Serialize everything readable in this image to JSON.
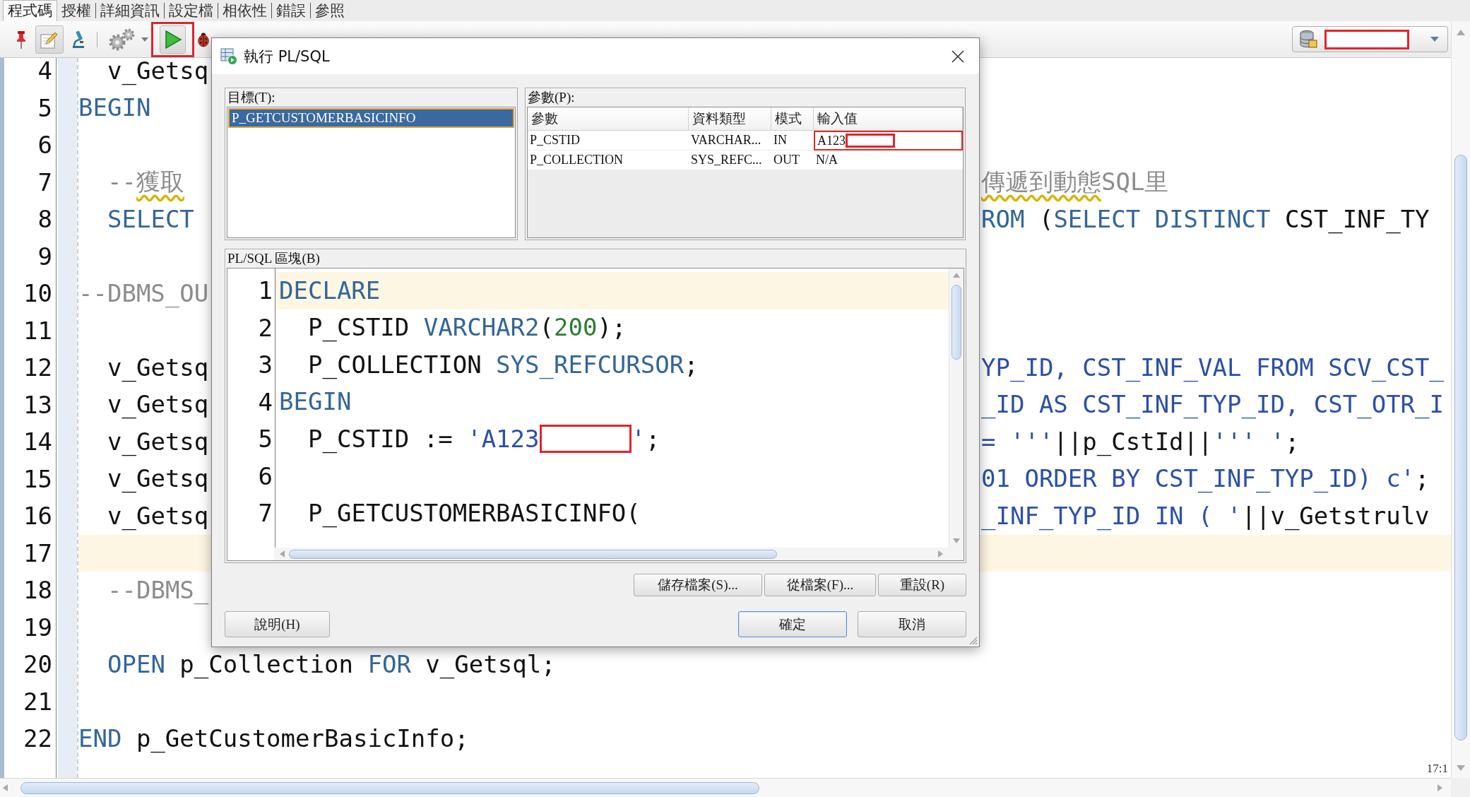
{
  "tabs": [
    {
      "label": "程式碼",
      "selected": true
    },
    {
      "label": "授權",
      "selected": false
    },
    {
      "label": "詳細資訊",
      "selected": false
    },
    {
      "label": "設定檔",
      "selected": false
    },
    {
      "label": "相依性",
      "selected": false
    },
    {
      "label": "錯誤",
      "selected": false
    },
    {
      "label": "參照",
      "selected": false
    }
  ],
  "toolbar": [
    {
      "kind": "pin",
      "pressed": false,
      "highlighted": false
    },
    {
      "kind": "edit",
      "pressed": true,
      "highlighted": false
    },
    {
      "kind": "inspect",
      "pressed": false,
      "highlighted": false
    },
    {
      "kind": "separator"
    },
    {
      "kind": "gears",
      "pressed": false,
      "highlighted": false
    },
    {
      "kind": "dropdown",
      "pressed": false,
      "highlighted": false
    },
    {
      "kind": "run",
      "pressed": true,
      "highlighted": true
    },
    {
      "kind": "debug",
      "pressed": false,
      "highlighted": false
    }
  ],
  "connection": {
    "redacted": true
  },
  "editor": {
    "lines": [
      {
        "number": "4",
        "current": false,
        "indented": true,
        "left": [
          {
            "kind": "plain",
            "text": "v_Getsq"
          }
        ]
      },
      {
        "number": "5",
        "current": false,
        "indented": false,
        "left": [
          {
            "kind": "keyword",
            "text": "BEGIN"
          }
        ]
      },
      {
        "number": "6",
        "current": false
      },
      {
        "number": "7",
        "current": false,
        "indented": true,
        "left": [
          {
            "kind": "comment",
            "text": "--"
          },
          {
            "kind": "flagged",
            "text": "獲取"
          }
        ],
        "right": [
          {
            "kind": "flagged",
            "text": "傳遞到動態"
          },
          {
            "kind": "comment",
            "text": "SQL里"
          }
        ]
      },
      {
        "number": "8",
        "current": false,
        "indented": true,
        "left": [
          {
            "kind": "keyword",
            "text": "SELECT"
          }
        ],
        "right": [
          {
            "kind": "keyword",
            "text": "ROM"
          },
          {
            "kind": "plain",
            "text": " ("
          },
          {
            "kind": "keyword",
            "text": "SELECT DISTINCT"
          },
          {
            "kind": "plain",
            "text": " CST_INF_TY"
          }
        ]
      },
      {
        "number": "9",
        "current": false
      },
      {
        "number": "10",
        "current": false,
        "indented": false,
        "left": [
          {
            "kind": "comment",
            "text": "--DBMS_OU"
          }
        ]
      },
      {
        "number": "11",
        "current": false
      },
      {
        "number": "12",
        "current": false,
        "indented": true,
        "left": [
          {
            "kind": "plain",
            "text": "v_Getsq"
          }
        ],
        "right": [
          {
            "kind": "string",
            "text": "YP_ID, CST_INF_VAL FROM SCV_CST_"
          }
        ]
      },
      {
        "number": "13",
        "current": false,
        "indented": true,
        "left": [
          {
            "kind": "plain",
            "text": "v_Getsq"
          }
        ],
        "right": [
          {
            "kind": "string",
            "text": "_ID AS CST_INF_TYP_ID, CST_OTR_I"
          }
        ]
      },
      {
        "number": "14",
        "current": false,
        "indented": true,
        "left": [
          {
            "kind": "plain",
            "text": "v_Getsq"
          }
        ],
        "right": [
          {
            "kind": "string",
            "text": "= '''"
          },
          {
            "kind": "plain",
            "text": "||p_CstId||"
          },
          {
            "kind": "string",
            "text": "''' '"
          },
          {
            "kind": "plain",
            "text": ";"
          }
        ]
      },
      {
        "number": "15",
        "current": false,
        "indented": true,
        "left": [
          {
            "kind": "plain",
            "text": "v_Getsq"
          }
        ],
        "right": [
          {
            "kind": "string",
            "text": "01 ORDER BY CST_INF_TYP_ID) c'"
          },
          {
            "kind": "plain",
            "text": ";"
          }
        ]
      },
      {
        "number": "16",
        "current": false,
        "indented": true,
        "left": [
          {
            "kind": "plain",
            "text": "v_Getsq"
          }
        ],
        "right": [
          {
            "kind": "string",
            "text": "_INF_TYP_ID IN ( '"
          },
          {
            "kind": "plain",
            "text": "||v_Getstrulv"
          }
        ]
      },
      {
        "number": "17",
        "current": true
      },
      {
        "number": "18",
        "current": false,
        "indented": true,
        "left": [
          {
            "kind": "comment",
            "text": "--DBMS_"
          }
        ]
      },
      {
        "number": "19",
        "current": false
      },
      {
        "number": "20",
        "current": false,
        "indented": true,
        "left": [
          {
            "kind": "keyword",
            "text": "OPEN"
          },
          {
            "kind": "plain",
            "text": " p_Collection "
          },
          {
            "kind": "keyword",
            "text": "FOR"
          },
          {
            "kind": "plain",
            "text": " v_Getsql;"
          }
        ]
      },
      {
        "number": "21",
        "current": false
      },
      {
        "number": "22",
        "current": false,
        "indented": false,
        "left": [
          {
            "kind": "keyword",
            "text": "END"
          },
          {
            "kind": "plain",
            "text": " p_GetCustomerBasicInfo;"
          }
        ]
      }
    ],
    "caret_position": "17:1"
  },
  "dialog": {
    "title": "執行 PL/SQL",
    "target": {
      "label": "目標(T):",
      "items": [
        {
          "name": "P_GETCUSTOMERBASICINFO",
          "selected": true
        }
      ]
    },
    "parameters": {
      "label": "參數(P):",
      "columns": [
        "參數",
        "資料類型",
        "模式",
        "輸入值"
      ],
      "rows": [
        {
          "name": "P_CSTID",
          "type": "VARCHAR...",
          "mode": "IN",
          "value": "A123",
          "redacted": true,
          "highlighted": true
        },
        {
          "name": "P_COLLECTION",
          "type": "SYS_REFC...",
          "mode": "OUT",
          "value": "N/A",
          "redacted": false,
          "highlighted": false
        }
      ]
    },
    "block": {
      "label": "PL/SQL 區塊(B)",
      "lines": [
        {
          "number": "1",
          "current": true,
          "indented": false,
          "parts": [
            {
              "kind": "code",
              "tokens": [
                {
                  "kind": "keyword",
                  "text": "DECLARE"
                }
              ]
            }
          ]
        },
        {
          "number": "2",
          "current": false,
          "indented": true,
          "parts": [
            {
              "kind": "code",
              "tokens": [
                {
                  "kind": "plain",
                  "text": "P_CSTID "
                },
                {
                  "kind": "keyword",
                  "text": "VARCHAR2"
                },
                {
                  "kind": "plain",
                  "text": "("
                },
                {
                  "kind": "number",
                  "text": "200"
                },
                {
                  "kind": "plain",
                  "text": ");"
                }
              ]
            }
          ]
        },
        {
          "number": "3",
          "current": false,
          "indented": true,
          "parts": [
            {
              "kind": "code",
              "tokens": [
                {
                  "kind": "plain",
                  "text": "P_COLLECTION "
                },
                {
                  "kind": "keyword",
                  "text": "SYS_REFCURSOR"
                },
                {
                  "kind": "plain",
                  "text": ";"
                }
              ]
            }
          ]
        },
        {
          "number": "4",
          "current": false,
          "indented": false,
          "parts": [
            {
              "kind": "code",
              "tokens": [
                {
                  "kind": "keyword",
                  "text": "BEGIN"
                }
              ]
            }
          ]
        },
        {
          "number": "5",
          "current": false,
          "indented": true,
          "parts": [
            {
              "kind": "code",
              "tokens": [
                {
                  "kind": "plain",
                  "text": "P_CSTID := "
                },
                {
                  "kind": "string",
                  "text": "'A123"
                }
              ]
            },
            {
              "kind": "redaction"
            },
            {
              "kind": "code",
              "tokens": [
                {
                  "kind": "string",
                  "text": "'"
                },
                {
                  "kind": "plain",
                  "text": ";"
                }
              ]
            }
          ]
        },
        {
          "number": "6",
          "current": false
        },
        {
          "number": "7",
          "current": false,
          "indented": true,
          "parts": [
            {
              "kind": "code",
              "tokens": [
                {
                  "kind": "plain",
                  "text": "P_GETCUSTOMERBASICINFO("
                }
              ]
            }
          ]
        }
      ]
    },
    "file_buttons": [
      "儲存檔案(S)...",
      "從檔案(F)...",
      "重設(R)"
    ],
    "help_button": "說明(H)",
    "buttons": [
      {
        "label": "確定",
        "default": true
      },
      {
        "label": "取消",
        "default": false
      }
    ]
  }
}
